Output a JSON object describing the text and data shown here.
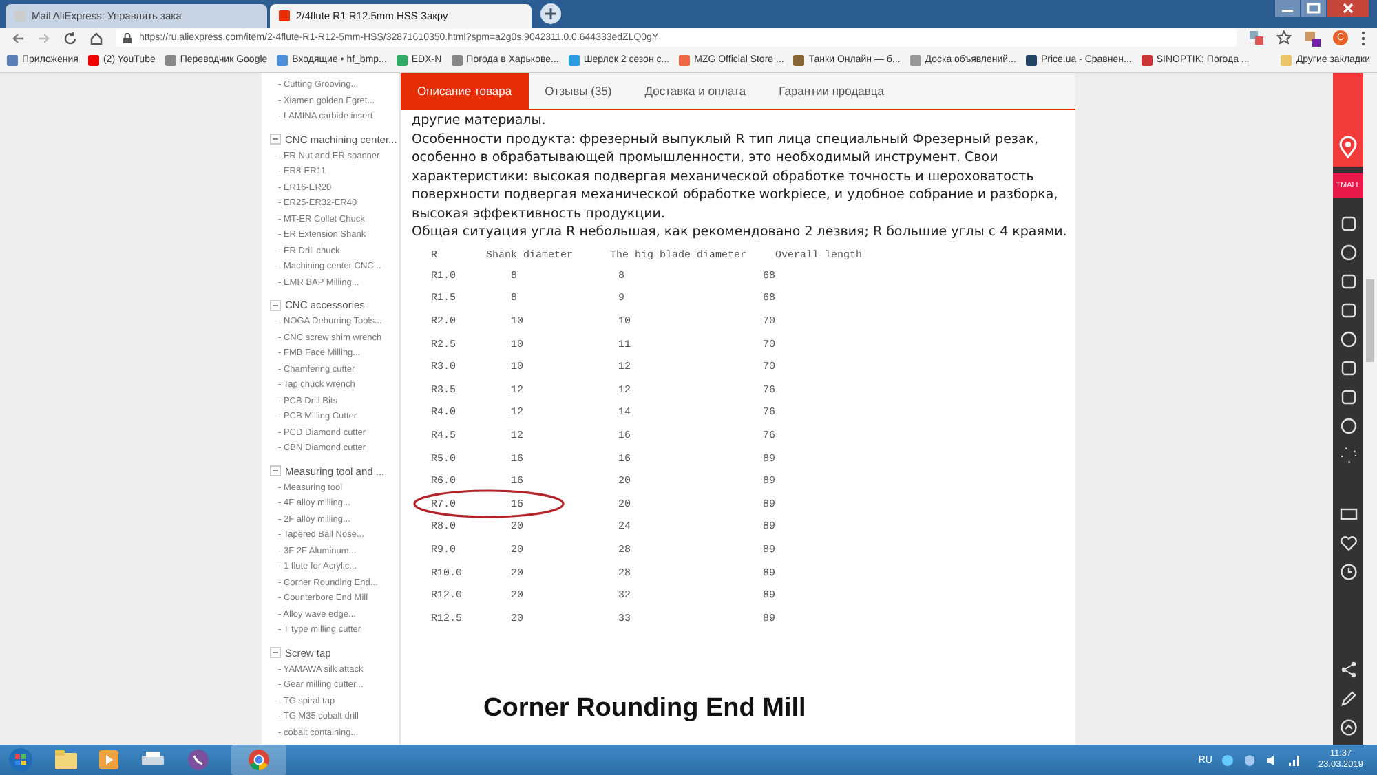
{
  "browser": {
    "tabs": [
      {
        "title": "Mail AliExpress: Управлять зака",
        "selected": false
      },
      {
        "title": "2/4flute R1 R12.5mm HSS Закру",
        "selected": true
      }
    ],
    "url": "https://ru.aliexpress.com/item/2-4flute-R1-R12-5mm-HSS/32871610350.html?spm=a2g0s.9042311.0.0.644333edZLQ0gY",
    "profile_initial": "C",
    "bookmarks": [
      "Приложения",
      "(2) YouTube",
      "Переводчик Google",
      "Входящие • hf_bmp...",
      "EDX-N",
      "Погода в Харькове...",
      "Шерлок 2 сезон с...",
      "MZG Official Store ...",
      "Танки Онлайн — б...",
      "Доска объявлений...",
      "Price.ua - Сравнен...",
      "SINOPTIK: Погода ...",
      "Другие закладки"
    ]
  },
  "sidebar": {
    "groups": [
      {
        "items": [
          "- Cutting Grooving...",
          "- Xiamen golden Egret...",
          "- LAMINA carbide insert"
        ]
      },
      {
        "title": "CNC machining center...",
        "expanded": true,
        "items": [
          "- ER Nut and ER spanner",
          "- ER8-ER11",
          "- ER16-ER20",
          "- ER25-ER32-ER40",
          "- MT-ER Collet Chuck",
          "- ER Extension Shank",
          "- ER Drill chuck",
          "- Machining center CNC...",
          "- EMR BAP Milling..."
        ]
      },
      {
        "title": "CNC accessories",
        "expanded": true,
        "items": [
          "- NOGA Deburring Tools...",
          "- CNC screw shim wrench",
          "- FMB Face Milling...",
          "- Chamfering cutter",
          "- Tap chuck wrench",
          "- PCB Drill Bits",
          "- PCB Milling Cutter",
          "- PCD Diamond cutter",
          "- CBN Diamond cutter"
        ]
      },
      {
        "title": "Measuring tool and ...",
        "expanded": true,
        "items": [
          "- Measuring tool",
          "- 4F alloy milling...",
          "- 2F alloy milling...",
          "- Tapered Ball Nose...",
          "- 3F 2F Aluminum...",
          "- 1 flute for Acrylic...",
          "- Corner Rounding End...",
          "- Counterbore End Mill",
          "- Alloy wave edge...",
          "- T type milling cutter"
        ]
      },
      {
        "title": "Screw tap",
        "expanded": true,
        "items": [
          "- YAMAWA silk attack",
          "- Gear milling cutter...",
          "- TG spiral tap",
          "- TG M35 cobalt drill",
          "- cobalt containing..."
        ]
      }
    ]
  },
  "product_tabs": [
    {
      "label": "Описание товара",
      "selected": true
    },
    {
      "label": "Отзывы (35)",
      "selected": false
    },
    {
      "label": "Доставка и оплата",
      "selected": false
    },
    {
      "label": "Гарантии продавца",
      "selected": false
    }
  ],
  "description": [
    "другие материалы.",
    "Особенности продукта: фрезерный выпуклый R тип лица специальный Фрезерный резак, особенно в обрабатывающей промышленности, это необходимый инструмент. Свои характеристики: высокая подвергая механической обработке точность и шероховатость поверхности подвергая механической обработке workpiece, и удобное собрание и разборка, высокая эффективность продукции.",
    "Общая ситуация угла R небольшая, как рекомендовано 2 лезвия; R большие углы с 4 краями."
  ],
  "table": {
    "columns": [
      "R",
      "Shank diameter",
      "The big blade diameter",
      "Overall length"
    ],
    "rows": [
      {
        "cells": [
          "R1.0",
          "8",
          "8",
          "68"
        ],
        "circled": false
      },
      {
        "cells": [
          "R1.5",
          "8",
          "9",
          "68"
        ],
        "circled": false
      },
      {
        "cells": [
          "R2.0",
          "10",
          "10",
          "70"
        ],
        "circled": false
      },
      {
        "cells": [
          "R2.5",
          "10",
          "11",
          "70"
        ],
        "circled": false
      },
      {
        "cells": [
          "R3.0",
          "10",
          "12",
          "70"
        ],
        "circled": false
      },
      {
        "cells": [
          "R3.5",
          "12",
          "12",
          "76"
        ],
        "circled": false
      },
      {
        "cells": [
          "R4.0",
          "12",
          "14",
          "76"
        ],
        "circled": false
      },
      {
        "cells": [
          "R4.5",
          "12",
          "16",
          "76"
        ],
        "circled": false
      },
      {
        "cells": [
          "R5.0",
          "16",
          "16",
          "89"
        ],
        "circled": false
      },
      {
        "cells": [
          "R6.0",
          "16",
          "20",
          "89"
        ],
        "circled": false
      },
      {
        "cells": [
          "R7.0",
          "16",
          "20",
          "89"
        ],
        "circled": true
      },
      {
        "cells": [
          "R8.0",
          "20",
          "24",
          "89"
        ],
        "circled": false
      },
      {
        "cells": [
          "R9.0",
          "20",
          "28",
          "89"
        ],
        "circled": false
      },
      {
        "cells": [
          "R10.0",
          "20",
          "28",
          "89"
        ],
        "circled": false
      },
      {
        "cells": [
          "R12.0",
          "20",
          "32",
          "89"
        ],
        "circled": false
      },
      {
        "cells": [
          "R12.5",
          "20",
          "33",
          "89"
        ],
        "circled": false
      }
    ]
  },
  "heading": "Corner Rounding End Mill",
  "right_rail": {
    "badge": "TMALL"
  },
  "taskbar": {
    "language": "RU",
    "time": "11:37",
    "date": "23.03.2019"
  }
}
